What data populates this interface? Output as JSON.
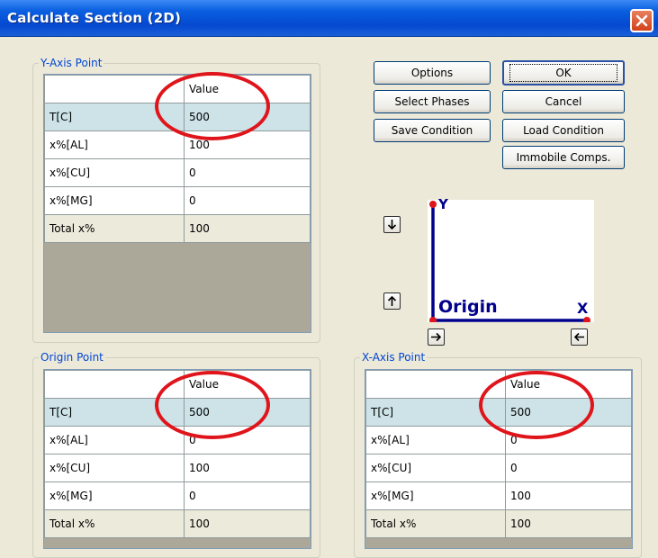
{
  "window": {
    "title": "Calculate Section (2D)"
  },
  "buttons": {
    "options": "Options",
    "ok": "OK",
    "select_phases": "Select Phases",
    "cancel": "Cancel",
    "save_condition": "Save Condition",
    "load_condition": "Load Condition",
    "immobile_comps": "Immobile Comps."
  },
  "y_axis_point": {
    "legend": "Y-Axis Point",
    "header": "Value",
    "rows": [
      {
        "label": "T[C]",
        "value": "500"
      },
      {
        "label": "x%[AL]",
        "value": "100"
      },
      {
        "label": "x%[CU]",
        "value": "0"
      },
      {
        "label": "x%[MG]",
        "value": "0"
      },
      {
        "label": "Total x%",
        "value": "100"
      }
    ]
  },
  "origin_point": {
    "legend": "Origin Point",
    "header": "Value",
    "rows": [
      {
        "label": "T[C]",
        "value": "500"
      },
      {
        "label": "x%[AL]",
        "value": "0"
      },
      {
        "label": "x%[CU]",
        "value": "100"
      },
      {
        "label": "x%[MG]",
        "value": "0"
      },
      {
        "label": "Total x%",
        "value": "100"
      }
    ]
  },
  "x_axis_point": {
    "legend": "X-Axis Point",
    "header": "Value",
    "rows": [
      {
        "label": "T[C]",
        "value": "500"
      },
      {
        "label": "x%[AL]",
        "value": "0"
      },
      {
        "label": "x%[CU]",
        "value": "0"
      },
      {
        "label": "x%[MG]",
        "value": "100"
      },
      {
        "label": "Total x%",
        "value": "100"
      }
    ]
  },
  "axis_diagram": {
    "y_label": "Y",
    "x_label": "X",
    "origin_label": "Origin",
    "axis_color": "#00008b",
    "point_color": "#e0151c"
  },
  "icons": {
    "close": "close-icon",
    "move_down": "arrow-down-icon",
    "move_up": "arrow-up-icon",
    "move_right": "arrow-right-icon",
    "move_left": "arrow-left-icon"
  },
  "colors": {
    "titlebar": "#0a5fe0",
    "legend_text": "#0046d5",
    "highlight_circle": "#e0151c",
    "selected_row": "#cde3e7",
    "total_row": "#ebeadb"
  }
}
